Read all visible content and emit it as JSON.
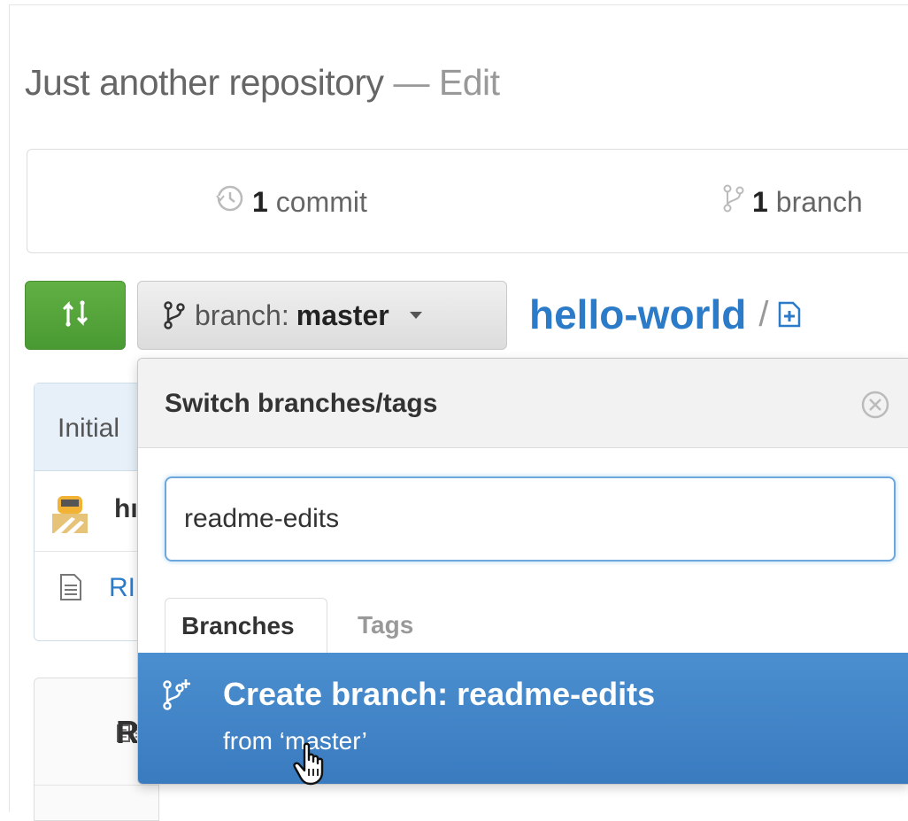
{
  "repo": {
    "title": "Just another repository",
    "separator": "—",
    "title_suffix": "Edit"
  },
  "stats": {
    "commits_count": "1",
    "commits_label": "commit",
    "branches_count": "1",
    "branches_label": "branch"
  },
  "toolbar": {
    "compare_icon": "compare-arrows-icon",
    "branch_prefix": "branch:",
    "branch_name": "master",
    "breadcrumb_repo": "hello-world",
    "breadcrumb_sep": "/",
    "add_file_icon": "add-file-icon"
  },
  "background": {
    "commit_title_partial": "Initial",
    "author_partial": "hı",
    "file_partial": "RI",
    "readme_partial": "R"
  },
  "dropdown": {
    "title": "Switch branches/tags",
    "filter_value": "readme-edits",
    "tabs": [
      {
        "label": "Branches",
        "active": true
      },
      {
        "label": "Tags",
        "active": false
      }
    ],
    "create_label": "Create branch: readme-edits",
    "create_from": "from ‘master’"
  },
  "colors": {
    "accent_blue": "#4183c4",
    "link_blue": "#2b7bc8",
    "compare_green": "#55a53b"
  }
}
